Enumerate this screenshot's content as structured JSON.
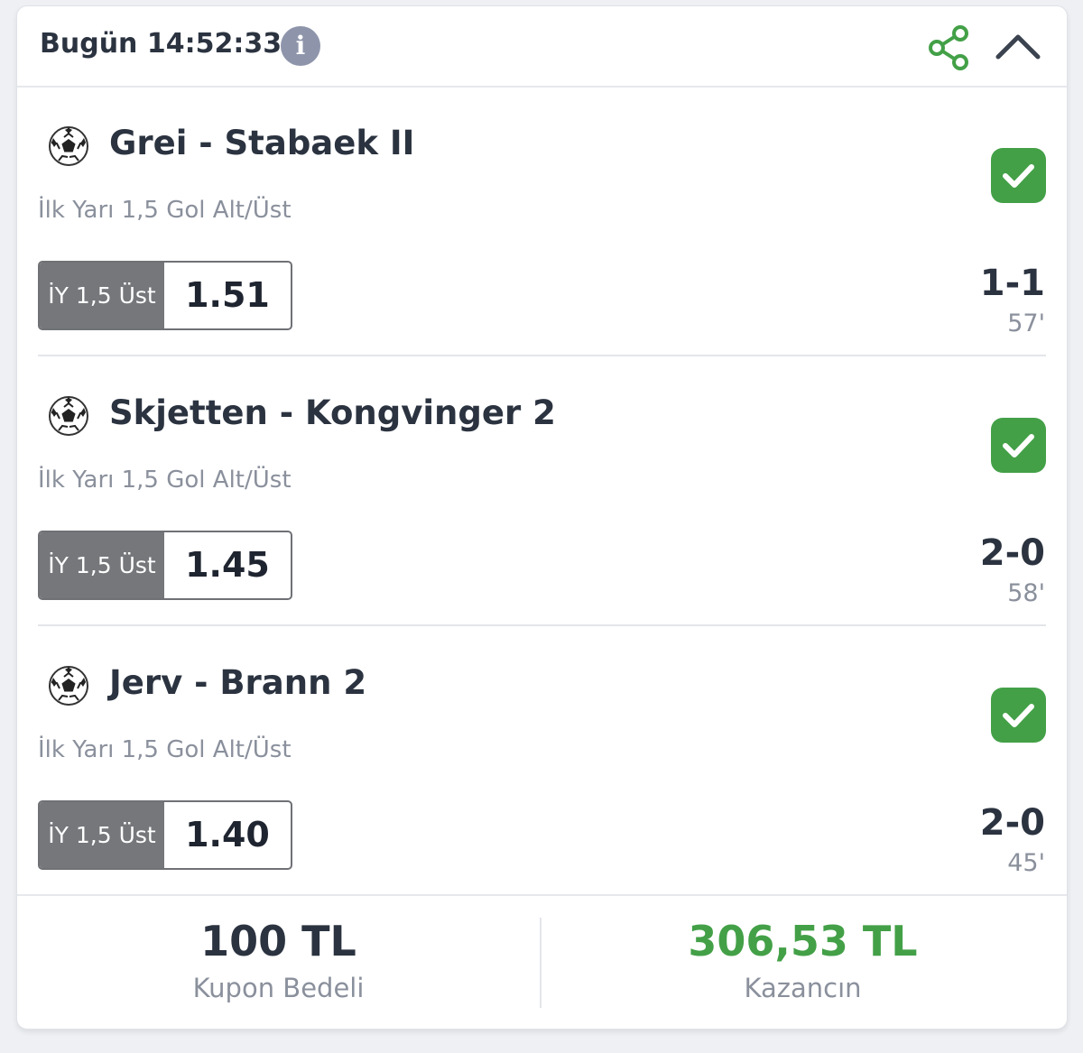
{
  "header": {
    "title": "Bugün 14:52:33",
    "info_icon": "info-icon",
    "share_icon": "share-icon",
    "collapse_icon": "chevron-up-icon"
  },
  "colors": {
    "accent_green": "#43a047",
    "text_dark": "#2b3340",
    "text_muted": "#8a909c",
    "bet_label_bg": "#75777b"
  },
  "matches": [
    {
      "name": "Grei - Stabaek II",
      "market": "İlk Yarı 1,5 Gol Alt/Üst",
      "bet_label": "İY 1,5 Üst",
      "odds": "1.51",
      "score": "1-1",
      "minute": "57'",
      "status": "won"
    },
    {
      "name": "Skjetten - Kongvinger 2",
      "market": "İlk Yarı 1,5 Gol Alt/Üst",
      "bet_label": "İY 1,5 Üst",
      "odds": "1.45",
      "score": "2-0",
      "minute": "58'",
      "status": "won"
    },
    {
      "name": "Jerv - Brann 2",
      "market": "İlk Yarı 1,5 Gol Alt/Üst",
      "bet_label": "İY 1,5 Üst",
      "odds": "1.40",
      "score": "2-0",
      "minute": "45'",
      "status": "won"
    }
  ],
  "footer": {
    "stake_value": "100 TL",
    "stake_label": "Kupon Bedeli",
    "win_value": "306,53 TL",
    "win_label": "Kazancın"
  }
}
